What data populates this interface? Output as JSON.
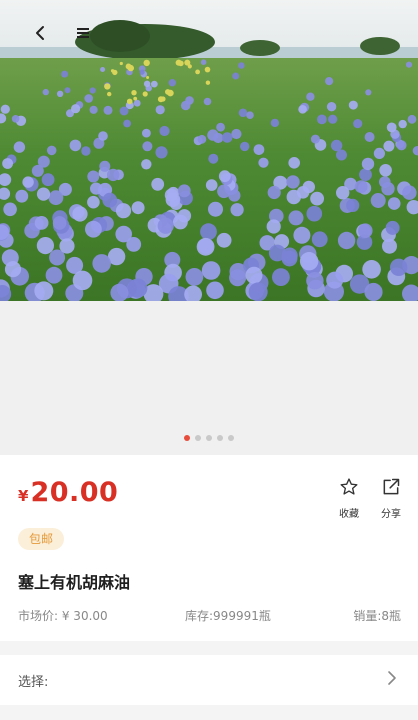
{
  "nav": {
    "back_icon": "back-arrow-icon",
    "menu_icon": "menu-icon"
  },
  "gallery": {
    "slide_count": 5,
    "active_index": 0
  },
  "product": {
    "currency": "¥",
    "price": "20.00",
    "favorite_label": "收藏",
    "share_label": "分享",
    "shipping_badge": "包邮",
    "title": "塞上有机胡麻油",
    "market_price": "市场价: ¥ 30.00",
    "stock": "库存:999991瓶",
    "sales": "销量:8瓶"
  },
  "spec": {
    "label": "选择:"
  },
  "colors": {
    "price_red": "#d93025",
    "badge_bg": "#fbefd9",
    "badge_text": "#e59a3a",
    "dot_active": "#e74c3c"
  }
}
